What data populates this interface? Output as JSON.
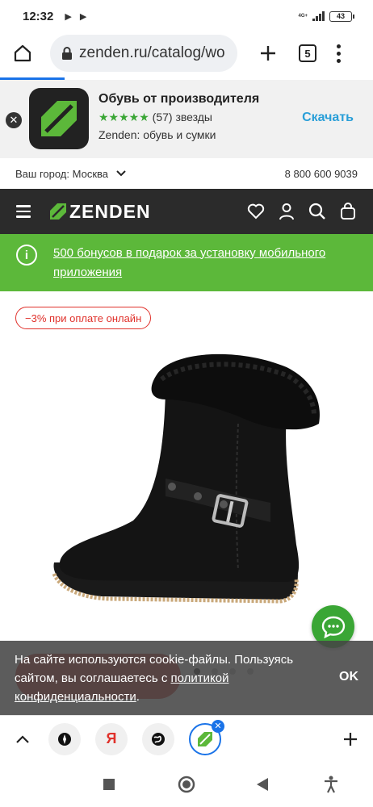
{
  "status_bar": {
    "time": "12:32",
    "network_label": "4G+",
    "battery": "43"
  },
  "browser": {
    "url": "zenden.ru/catalog/wo",
    "tab_count": "5"
  },
  "app_banner": {
    "title": "Обувь от производителя",
    "stars": "★★★★★",
    "rating_text": "(57) звезды",
    "subtitle": "Zenden: обувь и сумки",
    "download_label": "Скачать"
  },
  "city_bar": {
    "city_label": "Ваш город: Москва",
    "phone": "8 800 600 9039"
  },
  "site_header": {
    "logo_text": "ZENDEN"
  },
  "promo": {
    "text": "500 бонусов в подарок за установку мобильного приложения"
  },
  "product": {
    "discount_badge": "−3% при оплате онлайн"
  },
  "cookie_banner": {
    "text_before_link": "На сайте используются cookie-файлы. Пользуясь сайтом, вы соглашаетесь с ",
    "link_text": "политикой конфиденциальности",
    "text_after_link": ".",
    "ok_label": "OK"
  },
  "colors": {
    "brand_green": "#5cb83a",
    "header_dark": "#2b2b2b",
    "accent_red": "#e0312b",
    "link_blue": "#2a9fd8"
  }
}
